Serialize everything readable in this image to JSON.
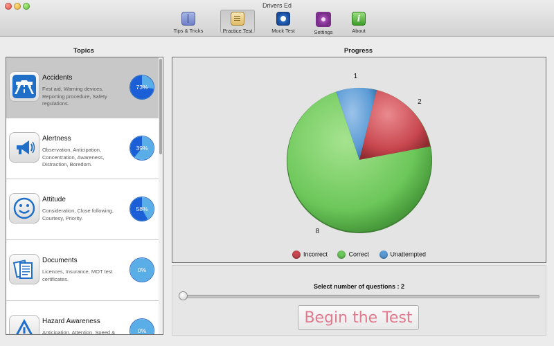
{
  "window": {
    "title": "Drivers Ed"
  },
  "toolbar": {
    "items": [
      {
        "label": "Tips & Tricks",
        "icon": "book-icon"
      },
      {
        "label": "Practice Test",
        "icon": "clipboard-icon"
      },
      {
        "label": "Mock Test",
        "icon": "stopwatch-icon"
      },
      {
        "label": "Settings",
        "icon": "gear-icon"
      },
      {
        "label": "About",
        "icon": "info-icon"
      }
    ],
    "selected_index": 1
  },
  "topics": {
    "heading": "Topics",
    "items": [
      {
        "name": "Accidents",
        "description": "First aid, Warning devices, Reporting procedure, Safety regulations.",
        "progress_label": "73%",
        "progress": 0.73,
        "icon": "road-accident-icon",
        "selected": true
      },
      {
        "name": "Alertness",
        "description": "Observation, Anticipation, Concentration, Awareness, Distraction, Boredom.",
        "progress_label": "39%",
        "progress": 0.39,
        "icon": "megaphone-icon",
        "selected": false
      },
      {
        "name": "Attitude",
        "description": "Consideration, Close following, Courtesy, Priority.",
        "progress_label": "58%",
        "progress": 0.58,
        "icon": "smiley-icon",
        "selected": false
      },
      {
        "name": "Documents",
        "description": "Licences, Insurance, MOT test certificates.",
        "progress_label": "0%",
        "progress": 0.0,
        "icon": "documents-icon",
        "selected": false
      },
      {
        "name": "Hazard Awareness",
        "description": "Anticipation, Attention, Speed &",
        "progress_label": "0%",
        "progress": 0.0,
        "icon": "warning-triangle-icon",
        "selected": false
      }
    ]
  },
  "progress": {
    "heading": "Progress"
  },
  "chart_data": {
    "type": "pie",
    "title": "",
    "slices": [
      {
        "name": "Incorrect",
        "value": 2,
        "color": "#c9474f"
      },
      {
        "name": "Correct",
        "value": 8,
        "color": "#6cc75a"
      },
      {
        "name": "Unattempted",
        "value": 1,
        "color": "#5b9bd5"
      }
    ],
    "data_labels": [
      "2",
      "8",
      "1"
    ],
    "legend": [
      "Incorrect",
      "Correct",
      "Unattempted"
    ],
    "legend_position": "bottom"
  },
  "question_selector": {
    "label": "Select number of questions : 2",
    "value": 2
  },
  "begin_button": {
    "label": "Begin the Test"
  },
  "colors": {
    "accent_blue": "#2b6bc5",
    "progress_fill": "#1a5fd6",
    "progress_base": "#5aaee8",
    "button_text": "#e07a8e"
  }
}
